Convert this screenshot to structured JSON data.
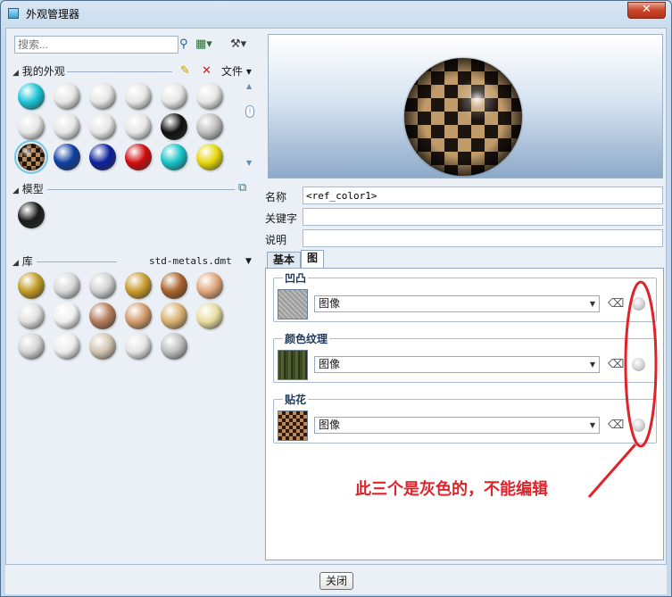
{
  "window": {
    "title": "外观管理器",
    "close_glyph": "✕"
  },
  "search": {
    "placeholder": "搜索..."
  },
  "icons": {
    "search": "search-icon",
    "view_mode": "view-mode-icon",
    "tools": "tools-icon",
    "new": "new-appearance-icon",
    "delete": "delete-icon",
    "model_action": "model-appearance-icon",
    "eraser": "eraser-icon",
    "glyphs": {
      "search": "⚲",
      "view": "▦▾",
      "tools": "⚒▾",
      "new": "✎",
      "delete": "✕",
      "model": "⧉",
      "eraser": "⌫"
    }
  },
  "my_appearances": {
    "label": "我的外观",
    "file_menu": "文件 ▾",
    "swatches": [
      {
        "color": "#19c3d6",
        "selected": false
      },
      {
        "color": "#e6e6e6",
        "selected": false
      },
      {
        "color": "#e6e6e6",
        "selected": false
      },
      {
        "color": "#e6e6e6",
        "selected": false
      },
      {
        "color": "#e6e6e6",
        "selected": false
      },
      {
        "color": "#e6e6e6",
        "selected": false
      },
      {
        "color": "#e6e6e6",
        "selected": false
      },
      {
        "color": "#e6e6e6",
        "selected": false
      },
      {
        "color": "#e6e6e6",
        "selected": false
      },
      {
        "color": "#e6e6e6",
        "selected": false
      },
      {
        "color": "#101010",
        "selected": false
      },
      {
        "color": "#bdbdbd",
        "selected": false
      },
      {
        "color": "checker",
        "selected": true
      },
      {
        "color": "#0d3d9e",
        "selected": false
      },
      {
        "color": "#0a1f9a",
        "selected": false
      },
      {
        "color": "#d10a0a",
        "selected": false
      },
      {
        "color": "#14c2c8",
        "selected": false
      },
      {
        "color": "#e6d60a",
        "selected": false
      }
    ]
  },
  "model": {
    "label": "模型",
    "swatches": [
      {
        "color": "#1a1a1a"
      }
    ]
  },
  "library": {
    "label": "库",
    "file": "std-metals.dmt",
    "swatches": [
      {
        "color": "#c09a22"
      },
      {
        "color": "#d8d8d8"
      },
      {
        "color": "#d0d0d0"
      },
      {
        "color": "#c89a2a"
      },
      {
        "color": "#a8622a"
      },
      {
        "color": "#e0a67a"
      },
      {
        "color": "#e0e0e0"
      },
      {
        "color": "#f0f0f0"
      },
      {
        "color": "#b47a5a"
      },
      {
        "color": "#d29a6a"
      },
      {
        "color": "#d8b070"
      },
      {
        "color": "#e8dca0"
      },
      {
        "color": "#d4d4d4"
      },
      {
        "color": "#ececec"
      },
      {
        "color": "#cfc4b0"
      },
      {
        "color": "#e4e4e4"
      },
      {
        "color": "#bdbdbd"
      }
    ]
  },
  "properties": {
    "name_label": "名称",
    "name_value": "<ref_color1>",
    "keyword_label": "关键字",
    "keyword_value": "",
    "description_label": "说明",
    "description_value": ""
  },
  "tabs": {
    "basic": "基本",
    "map": "图"
  },
  "maps": [
    {
      "title": "凹凸",
      "value": "图像",
      "thumb": "bump"
    },
    {
      "title": "颜色纹理",
      "value": "图像",
      "thumb": "texture"
    },
    {
      "title": "贴花",
      "value": "图像",
      "thumb": "decal"
    }
  ],
  "annotation": {
    "text": "此三个是灰色的，不能编辑",
    "color": "#e0222a"
  },
  "footer": {
    "close_label": "关闭"
  }
}
